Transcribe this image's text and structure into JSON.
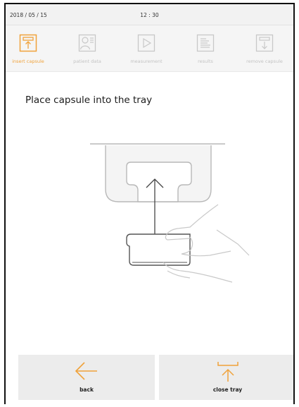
{
  "status": {
    "date": "2018 / 05 / 15",
    "time": "12 : 30"
  },
  "steps": [
    {
      "label": "insert capsule",
      "active": true
    },
    {
      "label": "patient data",
      "active": false
    },
    {
      "label": "measurement",
      "active": false
    },
    {
      "label": "results",
      "active": false
    },
    {
      "label": "remove capsule",
      "active": false
    }
  ],
  "instruction": "Place capsule into the tray",
  "buttons": {
    "back_label": "back",
    "close_tray_label": "close tray"
  },
  "colors": {
    "accent": "#f0a23a",
    "inactive": "#c8c8c8",
    "panel": "#ececec"
  }
}
